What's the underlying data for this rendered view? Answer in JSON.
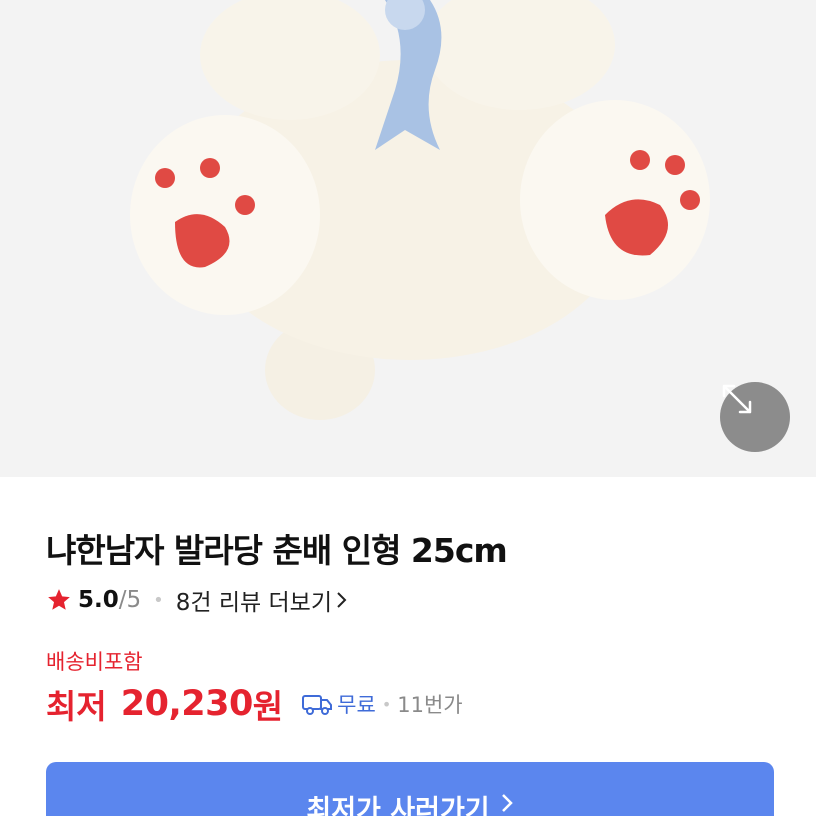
{
  "product": {
    "title": "냐한남자 발라당 춘배 인형 25cm",
    "image_alt": "product photo"
  },
  "rating": {
    "score": "5.0",
    "max": "/5",
    "review_link": "8건 리뷰 더보기"
  },
  "pricing": {
    "shipping_label": "배송비포함",
    "prefix": "최저",
    "price": "20,230",
    "unit": "원",
    "shipping_free": "무료",
    "seller": "11번가"
  },
  "cta": {
    "label": "최저가 사러가기"
  },
  "colors": {
    "accent_red": "#e5232f",
    "cta_blue": "#5b86ee",
    "free_blue": "#3f6bd8"
  },
  "icons": {
    "expand": "expand-icon",
    "star": "star-icon",
    "truck": "truck-icon",
    "chevron": "chevron-right-icon"
  }
}
